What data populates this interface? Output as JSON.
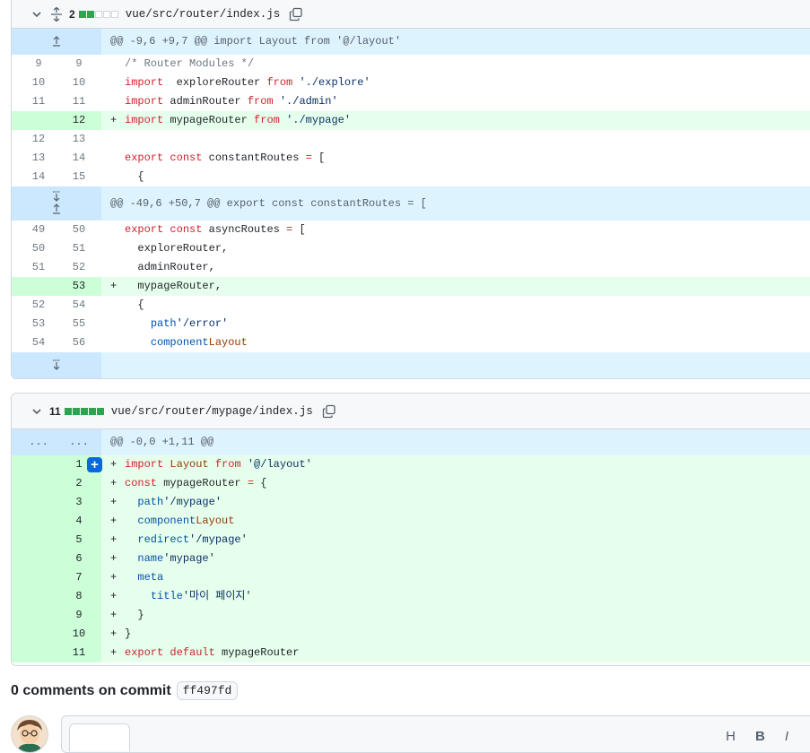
{
  "files": [
    {
      "count": "2",
      "blocks": [
        "g",
        "g",
        "n",
        "n",
        "n"
      ],
      "name": "vue/src/router/index.js",
      "rows": [
        {
          "type": "hunk",
          "exp": "up",
          "text": "@@ -9,6 +9,7 @@ import Layout from '@/layout'"
        },
        {
          "type": "ctx",
          "l": "9",
          "r": "9",
          "tokens": [
            [
              "cmt",
              "/* Router Modules */"
            ]
          ]
        },
        {
          "type": "ctx",
          "l": "10",
          "r": "10",
          "tokens": [
            [
              "kw",
              "import"
            ],
            [
              "",
              "  exploreRouter "
            ],
            [
              "kw",
              "from"
            ],
            [
              "",
              " "
            ],
            [
              "str",
              "'./explore'"
            ]
          ]
        },
        {
          "type": "ctx",
          "l": "11",
          "r": "11",
          "tokens": [
            [
              "kw",
              "import"
            ],
            [
              "",
              " adminRouter "
            ],
            [
              "kw",
              "from"
            ],
            [
              "",
              " "
            ],
            [
              "str",
              "'./admin'"
            ]
          ]
        },
        {
          "type": "add",
          "l": "",
          "r": "12",
          "tokens": [
            [
              "kw",
              "import"
            ],
            [
              "",
              " mypageRouter "
            ],
            [
              "kw",
              "from"
            ],
            [
              "",
              " "
            ],
            [
              "str",
              "'./mypage'"
            ]
          ]
        },
        {
          "type": "ctx",
          "l": "12",
          "r": "13",
          "tokens": []
        },
        {
          "type": "ctx",
          "l": "13",
          "r": "14",
          "tokens": [
            [
              "kw",
              "export"
            ],
            [
              "",
              " "
            ],
            [
              "kw",
              "const"
            ],
            [
              "",
              " constantRoutes "
            ],
            [
              "kw",
              "="
            ],
            [
              "",
              " ["
            ]
          ]
        },
        {
          "type": "ctx",
          "l": "14",
          "r": "15",
          "tokens": [
            [
              "",
              "  {"
            ]
          ]
        },
        {
          "type": "hunk",
          "exp": "both",
          "text": "@@ -49,6 +50,7 @@ export const constantRoutes = ["
        },
        {
          "type": "ctx",
          "l": "49",
          "r": "50",
          "tokens": [
            [
              "kw",
              "export"
            ],
            [
              "",
              " "
            ],
            [
              "kw",
              "const"
            ],
            [
              "",
              " asyncRoutes "
            ],
            [
              "kw",
              "="
            ],
            [
              "",
              " ["
            ]
          ]
        },
        {
          "type": "ctx",
          "l": "50",
          "r": "51",
          "tokens": [
            [
              "",
              "  exploreRouter,"
            ]
          ]
        },
        {
          "type": "ctx",
          "l": "51",
          "r": "52",
          "tokens": [
            [
              "",
              "  adminRouter,"
            ]
          ]
        },
        {
          "type": "add",
          "l": "",
          "r": "53",
          "tokens": [
            [
              "",
              "  mypageRouter,"
            ]
          ]
        },
        {
          "type": "ctx",
          "l": "52",
          "r": "54",
          "tokens": [
            [
              "",
              "  {"
            ]
          ]
        },
        {
          "type": "ctx",
          "l": "53",
          "r": "55",
          "tokens": [
            [
              "",
              "    "
            ],
            [
              "prop",
              "path"
            ],
            [
              ": "
            ],
            [
              "str",
              "'/error'"
            ],
            [
              ","
            ]
          ]
        },
        {
          "type": "ctx",
          "l": "54",
          "r": "56",
          "tokens": [
            [
              "",
              "    "
            ],
            [
              "prop",
              "component"
            ],
            [
              ": "
            ],
            [
              "fn",
              "Layout"
            ],
            [
              ","
            ]
          ]
        },
        {
          "type": "hunk",
          "exp": "down",
          "text": ""
        }
      ]
    },
    {
      "count": "11",
      "blocks": [
        "g",
        "g",
        "g",
        "g",
        "g"
      ],
      "name": "vue/src/router/mypage/index.js",
      "rows": [
        {
          "type": "dots",
          "l": "...",
          "r": "...",
          "text": "@@ -0,0 +1,11 @@"
        },
        {
          "type": "add",
          "l": "",
          "r": "1",
          "plus": true,
          "tokens": [
            [
              "kw",
              "import"
            ],
            [
              "",
              " "
            ],
            [
              "fn",
              "Layout"
            ],
            [
              "",
              " "
            ],
            [
              "kw",
              "from"
            ],
            [
              "",
              " "
            ],
            [
              "str",
              "'@/layout'"
            ]
          ]
        },
        {
          "type": "add",
          "l": "",
          "r": "2",
          "tokens": [
            [
              "kw",
              "const"
            ],
            [
              "",
              " mypageRouter "
            ],
            [
              "kw",
              "="
            ],
            [
              "",
              " {"
            ]
          ]
        },
        {
          "type": "add",
          "l": "",
          "r": "3",
          "tokens": [
            [
              "",
              "  "
            ],
            [
              "prop",
              "path"
            ],
            [
              ": "
            ],
            [
              "str",
              "'/mypage'"
            ],
            [
              ","
            ]
          ]
        },
        {
          "type": "add",
          "l": "",
          "r": "4",
          "tokens": [
            [
              "",
              "  "
            ],
            [
              "prop",
              "component"
            ],
            [
              ": "
            ],
            [
              "fn",
              "Layout"
            ],
            [
              ","
            ]
          ]
        },
        {
          "type": "add",
          "l": "",
          "r": "5",
          "tokens": [
            [
              "",
              "  "
            ],
            [
              "prop",
              "redirect"
            ],
            [
              ": "
            ],
            [
              "str",
              "'/mypage'"
            ],
            [
              ","
            ]
          ]
        },
        {
          "type": "add",
          "l": "",
          "r": "6",
          "tokens": [
            [
              "",
              "  "
            ],
            [
              "prop",
              "name"
            ],
            [
              ": "
            ],
            [
              "str",
              "'mypage'"
            ],
            [
              ","
            ]
          ]
        },
        {
          "type": "add",
          "l": "",
          "r": "7",
          "tokens": [
            [
              "",
              "  "
            ],
            [
              "prop",
              "meta"
            ],
            [
              ": {"
            ]
          ]
        },
        {
          "type": "add",
          "l": "",
          "r": "8",
          "tokens": [
            [
              "",
              "    "
            ],
            [
              "prop",
              "title"
            ],
            [
              ": "
            ],
            [
              "str",
              "'마이 페이지'"
            ]
          ]
        },
        {
          "type": "add",
          "l": "",
          "r": "9",
          "tokens": [
            [
              "",
              "  }"
            ]
          ]
        },
        {
          "type": "add",
          "l": "",
          "r": "10",
          "tokens": [
            [
              "",
              "}"
            ]
          ]
        },
        {
          "type": "add",
          "l": "",
          "r": "11",
          "tokens": [
            [
              "kw",
              "export"
            ],
            [
              "",
              " "
            ],
            [
              "kw",
              "default"
            ],
            [
              "",
              " mypageRouter"
            ]
          ]
        }
      ]
    }
  ],
  "comments": {
    "title": "0 comments on commit",
    "sha": "ff497fd"
  },
  "toolbar": [
    "H",
    "B",
    "I"
  ],
  "colors": {
    "accent": "#0969da",
    "add": "#e6ffec",
    "hunk": "#ddf4ff"
  }
}
